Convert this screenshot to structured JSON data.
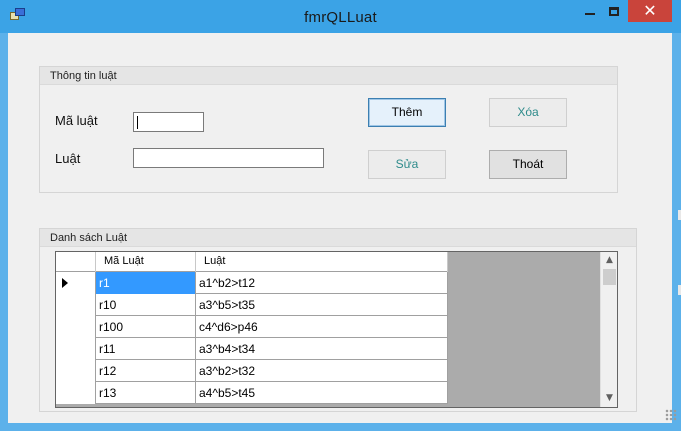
{
  "window": {
    "title": "fmrQLLuat",
    "minimize_glyph": "",
    "close_glyph": "✕"
  },
  "info_group": {
    "title": "Thông tin luật",
    "ma_luat_label": "Mã luật",
    "luat_label": "Luật",
    "ma_luat_value": "",
    "luat_value": "",
    "buttons": {
      "them": "Thêm",
      "xoa": "Xóa",
      "sua": "Sửa",
      "thoat": "Thoát"
    }
  },
  "list_group": {
    "title": "Danh sách Luật",
    "columns": [
      "Mã Luật",
      "Luật"
    ],
    "rows": [
      {
        "ma": "r1",
        "luat": "a1^b2>t12"
      },
      {
        "ma": "r10",
        "luat": "a3^b5>t35"
      },
      {
        "ma": "r100",
        "luat": "c4^d6>p46"
      },
      {
        "ma": "r11",
        "luat": "a3^b4>t34"
      },
      {
        "ma": "r12",
        "luat": "a3^b2>t32"
      },
      {
        "ma": "r13",
        "luat": "a4^b5>t45"
      }
    ],
    "selected_row": 0,
    "scroll_up_glyph": "▲",
    "scroll_down_glyph": "▼"
  },
  "colors": {
    "titlebar": "#3ba3e6",
    "close_button": "#c9443b",
    "selection": "#3399ff",
    "disabled_text": "#2e8b8b"
  }
}
